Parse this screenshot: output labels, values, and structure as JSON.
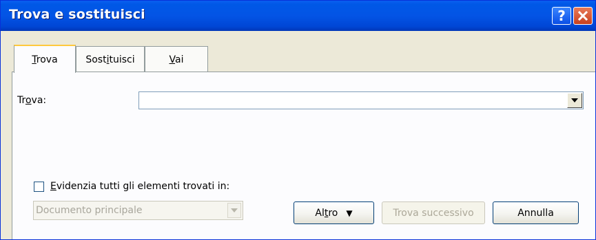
{
  "window": {
    "title": "Trova e sostituisci"
  },
  "title_buttons": {
    "help_icon": "help-icon",
    "close_icon": "close-icon"
  },
  "tabs": [
    {
      "label_prefix": "",
      "label_accel": "T",
      "label_rest": "rova",
      "active": true
    },
    {
      "label_prefix": "Sost",
      "label_accel": "i",
      "label_rest": "tuisci",
      "active": false
    },
    {
      "label_prefix": "",
      "label_accel": "V",
      "label_rest": "ai",
      "active": false
    }
  ],
  "find": {
    "label_prefix": "Tr",
    "label_accel": "o",
    "label_rest": "va:",
    "value": ""
  },
  "highlight": {
    "checked": false,
    "label_prefix": "",
    "label_accel": "E",
    "label_rest": "videnzia tutti gli elementi trovati in:"
  },
  "scope_select": {
    "value": "Documento principale",
    "disabled": true
  },
  "buttons": {
    "more_prefix": "Al",
    "more_accel": "t",
    "more_rest": "ro",
    "more_arrow": "▼",
    "find_next": "Trova successivo",
    "cancel": "Annulla"
  },
  "colors": {
    "titlebar": "#0054e3",
    "dialog_bg": "#ece9d8",
    "tab_highlight": "#ffc83c"
  }
}
